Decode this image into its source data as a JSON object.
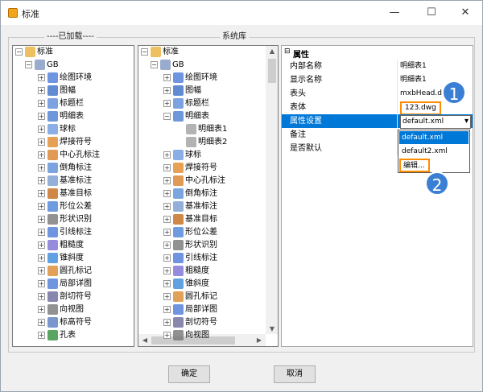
{
  "window": {
    "title": "标准",
    "buttons": {
      "min": "—",
      "max": "☐",
      "close": "✕"
    }
  },
  "loaded": {
    "label": "----已加载----",
    "root": "标准",
    "gb": "GB",
    "items": [
      "绘图环境",
      "图幅",
      "标题栏",
      "明细表",
      "球标",
      "焊接符号",
      "中心孔标注",
      "倒角标注",
      "基准标注",
      "基准目标",
      "形位公差",
      "形状识别",
      "引线标注",
      "粗糙度",
      "锥斜度",
      "圆孔标记",
      "局部详图",
      "剖切符号",
      "向视图",
      "标高符号",
      "孔表"
    ]
  },
  "system": {
    "label": "系统库",
    "root": "标准",
    "gb": "GB",
    "top": [
      "绘图环境",
      "图幅",
      "标题栏",
      "明细表"
    ],
    "children": [
      "明细表1",
      "明细表2"
    ],
    "items": [
      "球标",
      "焊接符号",
      "中心孔标注",
      "倒角标注",
      "基准标注",
      "基准目标",
      "形位公差",
      "形状识别",
      "引线标注",
      "粗糙度",
      "锥斜度",
      "圆孔标记",
      "局部详图",
      "剖切符号",
      "向视图"
    ]
  },
  "props": {
    "header": "属性",
    "rows": [
      {
        "name": "内部名称",
        "value": "明细表1"
      },
      {
        "name": "显示名称",
        "value": "明细表1"
      },
      {
        "name": "表头",
        "value": "mxbHead.dwg"
      },
      {
        "name": "表体",
        "value": "123.dwg"
      },
      {
        "name": "属性设置",
        "value": "default.xml"
      },
      {
        "name": "备注",
        "value": ""
      },
      {
        "name": "是否默认",
        "value": ""
      }
    ],
    "dropdown": [
      "default.xml",
      "default2.xml",
      "编辑..."
    ]
  },
  "buttons": {
    "ok": "确定",
    "cancel": "取消"
  },
  "callouts": [
    "1",
    "2"
  ]
}
